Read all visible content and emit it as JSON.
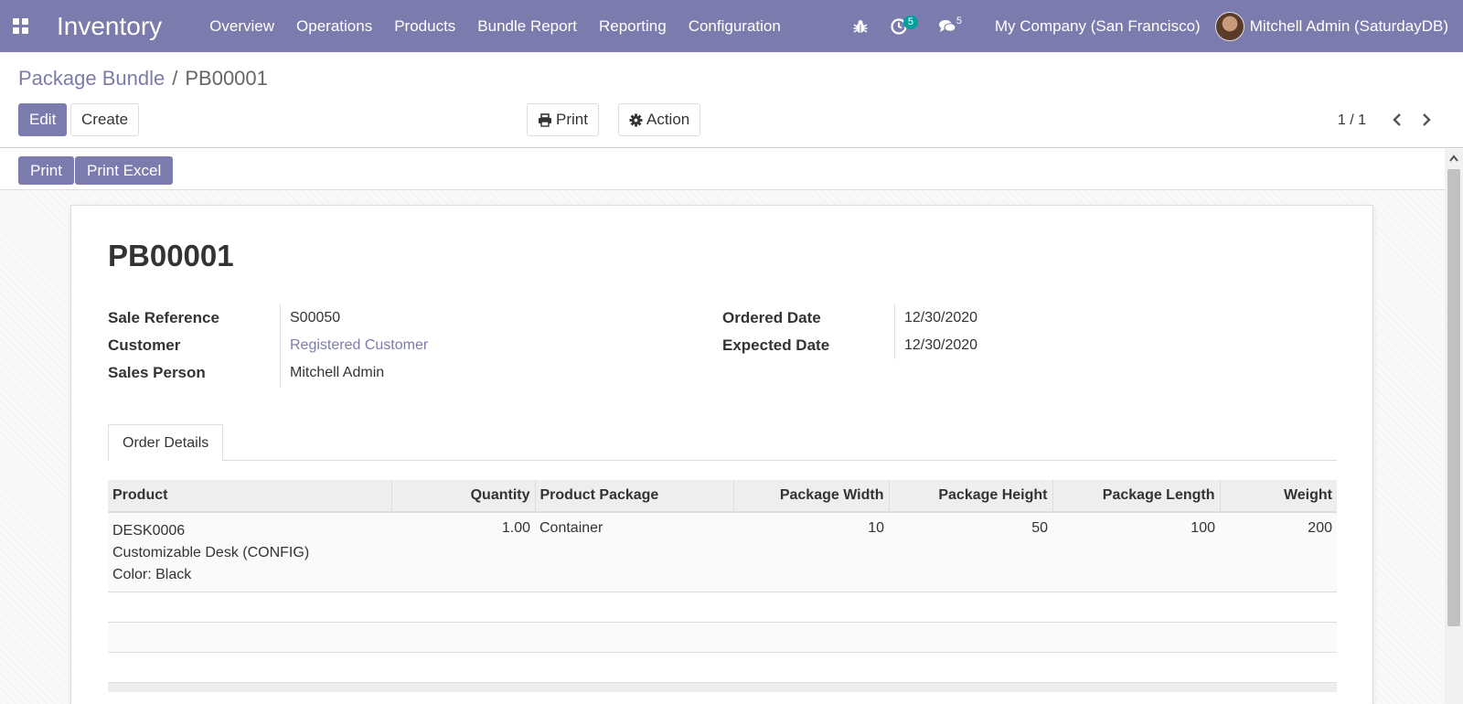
{
  "navbar": {
    "brand": "Inventory",
    "menu": [
      "Overview",
      "Operations",
      "Products",
      "Bundle Report",
      "Reporting",
      "Configuration"
    ],
    "activity_count": "5",
    "messages_count": "5",
    "company": "My Company (San Francisco)",
    "user": "Mitchell Admin (SaturdayDB)"
  },
  "breadcrumb": {
    "parent": "Package Bundle",
    "separator": "/",
    "current": "PB00001"
  },
  "control_panel": {
    "edit_label": "Edit",
    "create_label": "Create",
    "print_label": "Print",
    "action_label": "Action",
    "pager": "1 / 1"
  },
  "statusbar": {
    "print_label": "Print",
    "print_excel_label": "Print Excel"
  },
  "record": {
    "title": "PB00001",
    "left_fields": [
      {
        "label": "Sale Reference",
        "value": "S00050"
      },
      {
        "label": "Customer",
        "value": "Registered Customer"
      },
      {
        "label": "Sales Person",
        "value": "Mitchell Admin"
      }
    ],
    "right_fields": [
      {
        "label": "Ordered Date",
        "value": "12/30/2020"
      },
      {
        "label": "Expected Date",
        "value": "12/30/2020"
      }
    ],
    "tab": "Order Details",
    "columns": [
      "Product",
      "Quantity",
      "Product Package",
      "Package Width",
      "Package Height",
      "Package Length",
      "Weight"
    ],
    "lines": [
      {
        "product_lines": [
          "DESK0006",
          "Customizable Desk (CONFIG)",
          "Color: Black"
        ],
        "quantity": "1.00",
        "package": "Container",
        "width": "10",
        "height": "50",
        "length": "100",
        "weight": "200"
      }
    ]
  },
  "colors": {
    "brand": "#7C7BAD",
    "badge": "#00A09D"
  }
}
